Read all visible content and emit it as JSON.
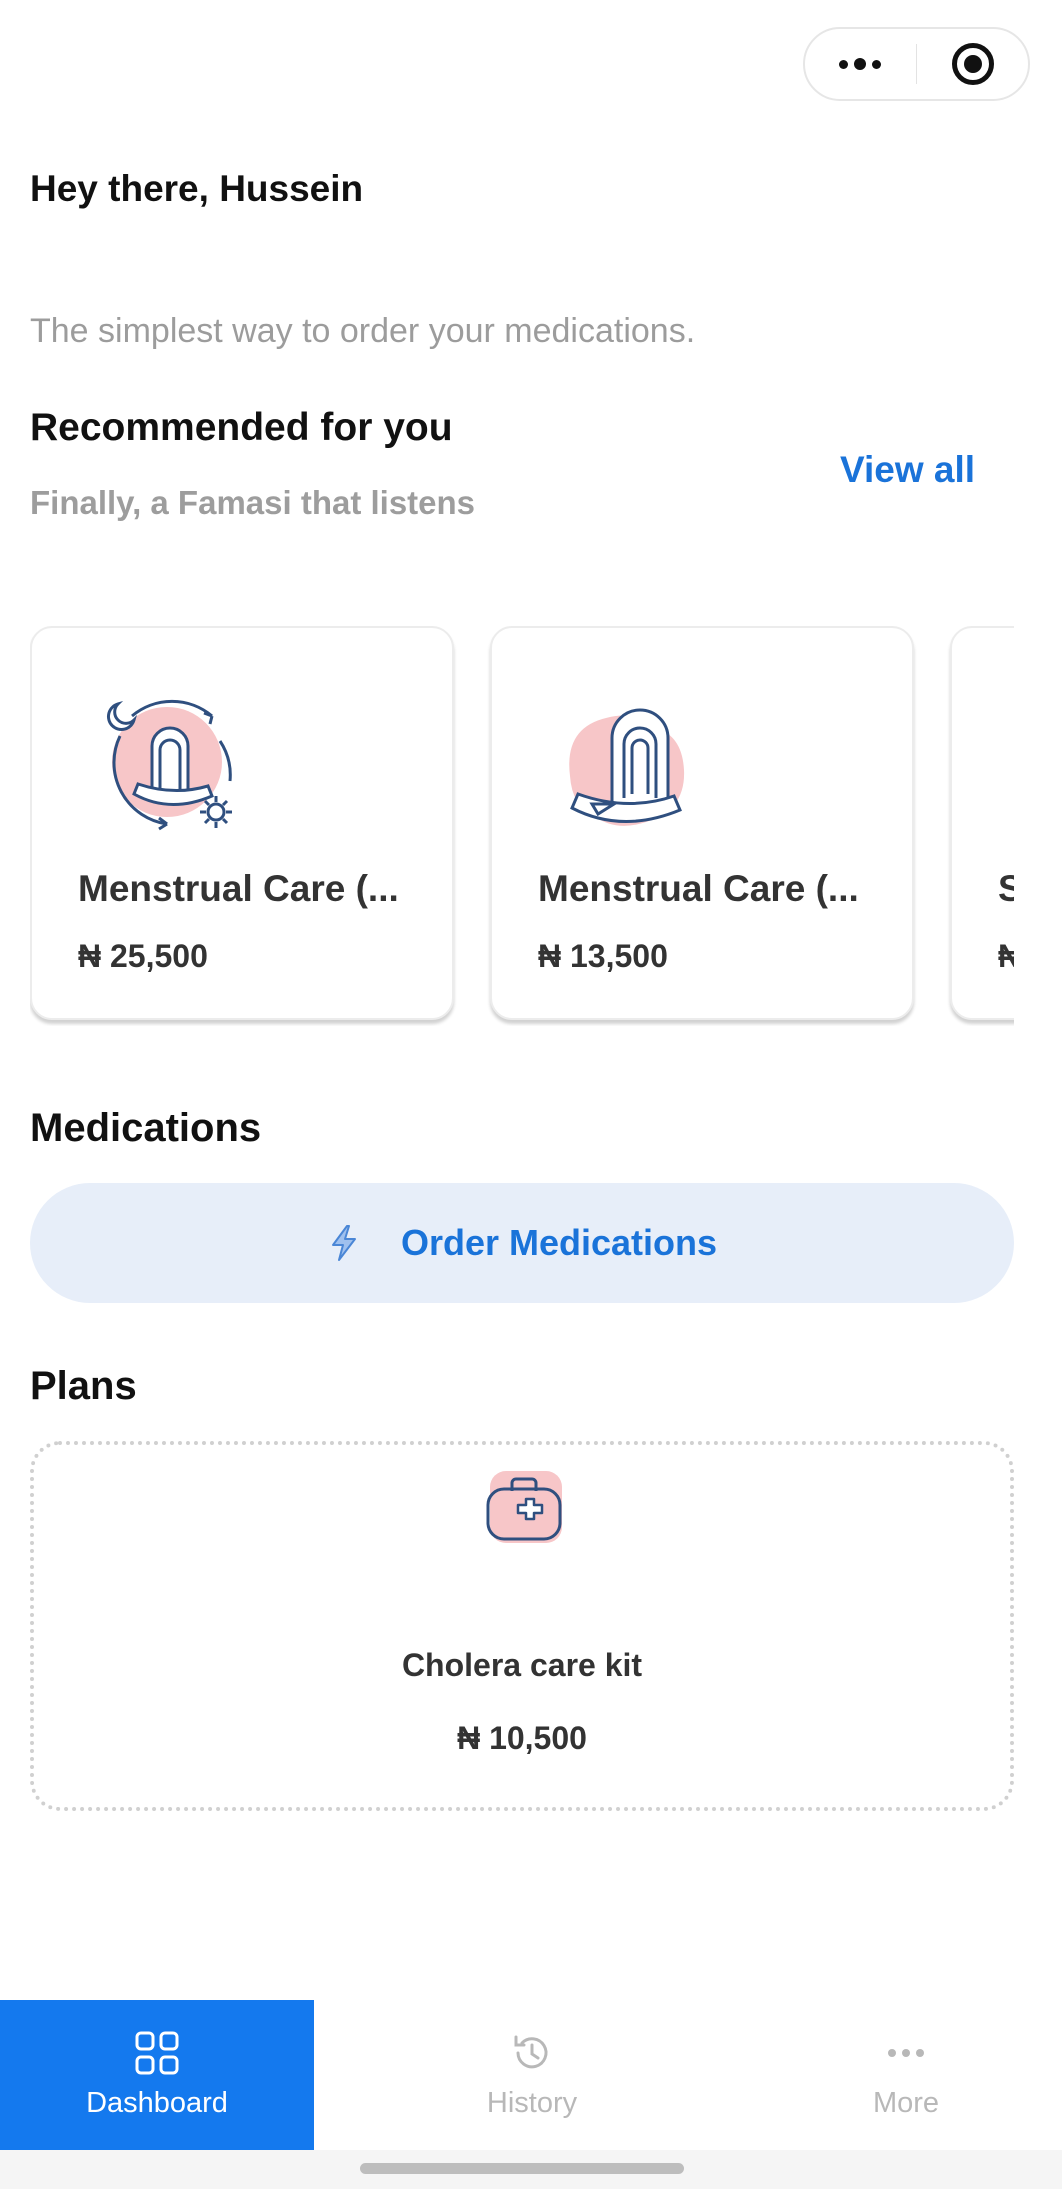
{
  "header": {
    "greeting": "Hey there, Hussein",
    "subtitle": "The simplest way to order your medications."
  },
  "recommended": {
    "title": "Recommended for you",
    "subtitle": "Finally, a Famasi that listens",
    "view_all_label": "View all",
    "products": [
      {
        "name": "Menstrual Care (...",
        "price": "₦ 25,500",
        "icon": "pad-day-night-icon"
      },
      {
        "name": "Menstrual Care (...",
        "price": "₦ 13,500",
        "icon": "pad-icon"
      },
      {
        "name": "S",
        "price": "₦",
        "icon": "product-icon"
      }
    ]
  },
  "medications": {
    "title": "Medications",
    "order_label": "Order Medications",
    "order_icon": "lightning-icon"
  },
  "plans": {
    "title": "Plans",
    "items": [
      {
        "name": "Cholera care kit",
        "price": "₦ 10,500",
        "icon": "medical-bag-icon"
      }
    ]
  },
  "tabbar": {
    "items": [
      {
        "label": "Dashboard",
        "icon": "grid-icon",
        "active": true
      },
      {
        "label": "History",
        "icon": "history-icon",
        "active": false
      },
      {
        "label": "More",
        "icon": "more-dots-icon",
        "active": false
      }
    ]
  },
  "colors": {
    "accent": "#1a73d9",
    "tab_active": "#1479ee",
    "order_button_bg": "#e7eef9",
    "illustration_pink": "#f7c6c8",
    "illustration_navy": "#2f4f7f"
  }
}
